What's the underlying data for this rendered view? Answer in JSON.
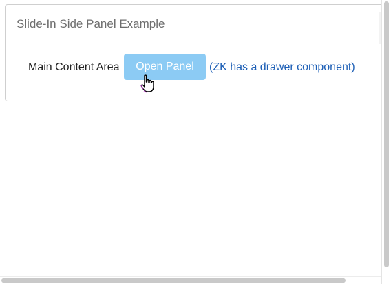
{
  "panel": {
    "title": "Slide-In Side Panel Example",
    "main_label": "Main Content Area",
    "open_button_label": "Open Panel",
    "drawer_link_text": "(ZK has a drawer component)"
  },
  "colors": {
    "button_bg": "#8ccbf4",
    "link": "#1d5fb6",
    "title_text": "#6e6e6e",
    "border": "#cfcfcf"
  },
  "cursor": {
    "icon": "hand-pointer-icon"
  }
}
